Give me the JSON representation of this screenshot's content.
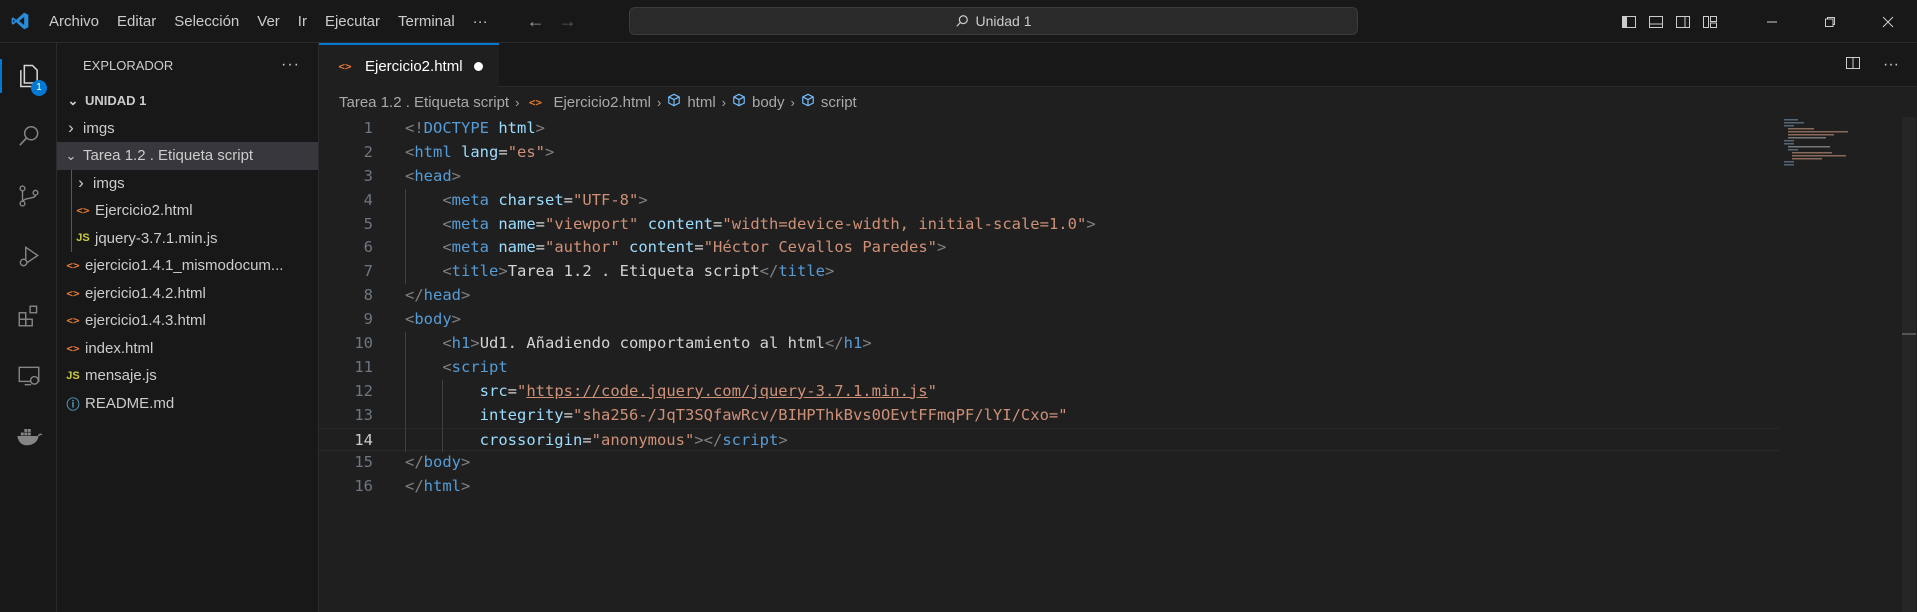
{
  "titlebar": {
    "menu": [
      "Archivo",
      "Editar",
      "Selección",
      "Ver",
      "Ir",
      "Ejecutar",
      "Terminal",
      "···"
    ],
    "search_text": "Unidad 1"
  },
  "activitybar": {
    "items": [
      "explorer-icon",
      "search-icon",
      "source-control-icon",
      "run-debug-icon",
      "extensions-icon",
      "remote-explorer-icon",
      "docker-icon"
    ],
    "explorer_badge": "1"
  },
  "sidebar": {
    "title": "EXPLORADOR",
    "more": "···",
    "root": "UNIDAD 1",
    "items": [
      {
        "label": "imgs",
        "type": "folder",
        "indent": 1,
        "expanded": false
      },
      {
        "label": "Tarea 1.2 . Etiqueta script",
        "type": "folder",
        "indent": 1,
        "expanded": true
      },
      {
        "label": "imgs",
        "type": "folder",
        "indent": 2,
        "expanded": false
      },
      {
        "label": "Ejercicio2.html",
        "type": "html",
        "indent": 2
      },
      {
        "label": "jquery-3.7.1.min.js",
        "type": "js",
        "indent": 2
      },
      {
        "label": "ejercicio1.4.1_mismodocum...",
        "type": "html",
        "indent": 1
      },
      {
        "label": "ejercicio1.4.2.html",
        "type": "html",
        "indent": 1
      },
      {
        "label": "ejercicio1.4.3.html",
        "type": "html",
        "indent": 1
      },
      {
        "label": "index.html",
        "type": "html",
        "indent": 1
      },
      {
        "label": "mensaje.js",
        "type": "js",
        "indent": 1
      },
      {
        "label": "README.md",
        "type": "info",
        "indent": 1
      }
    ]
  },
  "editor": {
    "tab_label": "Ejercicio2.html",
    "breadcrumb": [
      "Tarea 1.2 . Etiqueta script",
      "Ejercicio2.html",
      "html",
      "body",
      "script"
    ],
    "current_line": 14,
    "lines": [
      [
        [
          "br",
          "<!"
        ],
        [
          "tag",
          "DOCTYPE"
        ],
        [
          "txt",
          " "
        ],
        [
          "attr",
          "html"
        ],
        [
          "br",
          ">"
        ]
      ],
      [
        [
          "br",
          "<"
        ],
        [
          "tag",
          "html"
        ],
        [
          "txt",
          " "
        ],
        [
          "attr",
          "lang"
        ],
        [
          "txt",
          "="
        ],
        [
          "str",
          "\"es\""
        ],
        [
          "br",
          ">"
        ]
      ],
      [
        [
          "br",
          "<"
        ],
        [
          "tag",
          "head"
        ],
        [
          "br",
          ">"
        ]
      ],
      [
        [
          "txt",
          "    "
        ],
        [
          "br",
          "<"
        ],
        [
          "tag",
          "meta"
        ],
        [
          "txt",
          " "
        ],
        [
          "attr",
          "charset"
        ],
        [
          "txt",
          "="
        ],
        [
          "str",
          "\"UTF-8\""
        ],
        [
          "br",
          ">"
        ]
      ],
      [
        [
          "txt",
          "    "
        ],
        [
          "br",
          "<"
        ],
        [
          "tag",
          "meta"
        ],
        [
          "txt",
          " "
        ],
        [
          "attr",
          "name"
        ],
        [
          "txt",
          "="
        ],
        [
          "str",
          "\"viewport\""
        ],
        [
          "txt",
          " "
        ],
        [
          "attr",
          "content"
        ],
        [
          "txt",
          "="
        ],
        [
          "str",
          "\"width=device-width, initial-scale=1.0\""
        ],
        [
          "br",
          ">"
        ]
      ],
      [
        [
          "txt",
          "    "
        ],
        [
          "br",
          "<"
        ],
        [
          "tag",
          "meta"
        ],
        [
          "txt",
          " "
        ],
        [
          "attr",
          "name"
        ],
        [
          "txt",
          "="
        ],
        [
          "str",
          "\"author\""
        ],
        [
          "txt",
          " "
        ],
        [
          "attr",
          "content"
        ],
        [
          "txt",
          "="
        ],
        [
          "str",
          "\"Héctor Cevallos Paredes\""
        ],
        [
          "br",
          ">"
        ]
      ],
      [
        [
          "txt",
          "    "
        ],
        [
          "br",
          "<"
        ],
        [
          "tag",
          "title"
        ],
        [
          "br",
          ">"
        ],
        [
          "txt",
          "Tarea 1.2 . Etiqueta script"
        ],
        [
          "br",
          "</"
        ],
        [
          "tag",
          "title"
        ],
        [
          "br",
          ">"
        ]
      ],
      [
        [
          "br",
          "</"
        ],
        [
          "tag",
          "head"
        ],
        [
          "br",
          ">"
        ]
      ],
      [
        [
          "br",
          "<"
        ],
        [
          "tag",
          "body"
        ],
        [
          "br",
          ">"
        ]
      ],
      [
        [
          "txt",
          "    "
        ],
        [
          "br",
          "<"
        ],
        [
          "tag",
          "h1"
        ],
        [
          "br",
          ">"
        ],
        [
          "txt",
          "Ud1. Añadiendo comportamiento al html"
        ],
        [
          "br",
          "</"
        ],
        [
          "tag",
          "h1"
        ],
        [
          "br",
          ">"
        ]
      ],
      [
        [
          "txt",
          "    "
        ],
        [
          "br",
          "<"
        ],
        [
          "tag",
          "script"
        ]
      ],
      [
        [
          "txt",
          "        "
        ],
        [
          "attr",
          "src"
        ],
        [
          "txt",
          "="
        ],
        [
          "str",
          "\""
        ],
        [
          "url",
          "https://code.jquery.com/jquery-3.7.1.min.js"
        ],
        [
          "str",
          "\""
        ]
      ],
      [
        [
          "txt",
          "        "
        ],
        [
          "attr",
          "integrity"
        ],
        [
          "txt",
          "="
        ],
        [
          "str",
          "\"sha256-/JqT3SQfawRcv/BIHPThkBvs0OEvtFFmqPF/lYI/Cxo=\""
        ]
      ],
      [
        [
          "txt",
          "        "
        ],
        [
          "attr",
          "crossorigin"
        ],
        [
          "txt",
          "="
        ],
        [
          "str",
          "\"anonymous\""
        ],
        [
          "br",
          "></"
        ],
        [
          "tag",
          "script"
        ],
        [
          "br",
          ">"
        ]
      ],
      [
        [
          "br",
          "</"
        ],
        [
          "tag",
          "body"
        ],
        [
          "br",
          ">"
        ]
      ],
      [
        [
          "br",
          "</"
        ],
        [
          "tag",
          "html"
        ],
        [
          "br",
          ">"
        ]
      ]
    ]
  },
  "colors": {
    "accent": "#0078d4",
    "tag": "#569cd6",
    "attr": "#9cdcfe",
    "string": "#ce9178",
    "html_icon": "#e37933",
    "js_icon": "#cbcb41"
  }
}
